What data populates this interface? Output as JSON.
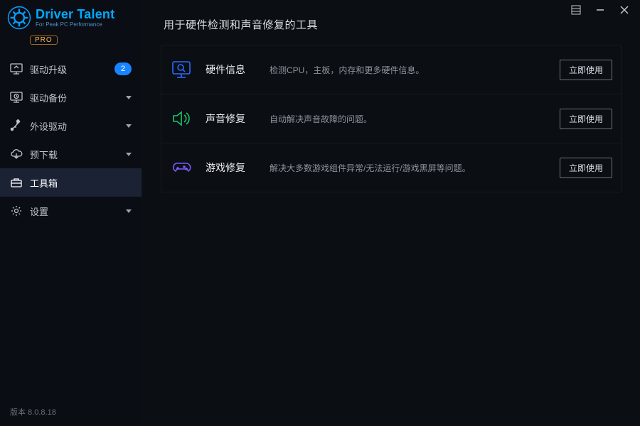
{
  "brand": {
    "title": "Driver Talent",
    "subtitle": "For Peak PC Performance",
    "pro_label": "PRO"
  },
  "titlebar": {
    "menu": "menu",
    "min": "minimize",
    "close": "close"
  },
  "sidebar": {
    "items": [
      {
        "id": "upgrade",
        "label": "驱动升级",
        "badge": "2",
        "caret": false
      },
      {
        "id": "backup",
        "label": "驱动备份",
        "badge": null,
        "caret": true
      },
      {
        "id": "periph",
        "label": "外设驱动",
        "badge": null,
        "caret": true
      },
      {
        "id": "predl",
        "label": "预下载",
        "badge": null,
        "caret": true
      },
      {
        "id": "toolbox",
        "label": "工具箱",
        "badge": null,
        "caret": false,
        "active": true
      },
      {
        "id": "settings",
        "label": "设置",
        "badge": null,
        "caret": true
      }
    ],
    "version_label": "版本 8.0.8.18"
  },
  "main": {
    "title": "用于硬件检测和声音修复的工具",
    "use_label": "立即使用",
    "tools": [
      {
        "id": "hw",
        "name": "硬件信息",
        "desc": "检测CPU，主板，内存和更多硬件信息。",
        "color": "#2a6bff"
      },
      {
        "id": "sound",
        "name": "声音修复",
        "desc": "自动解决声音故障的问题。",
        "color": "#18c96b"
      },
      {
        "id": "game",
        "name": "游戏修复",
        "desc": "解决大多数游戏组件异常/无法运行/游戏黑屏等问题。",
        "color": "#7b5bff"
      }
    ]
  }
}
